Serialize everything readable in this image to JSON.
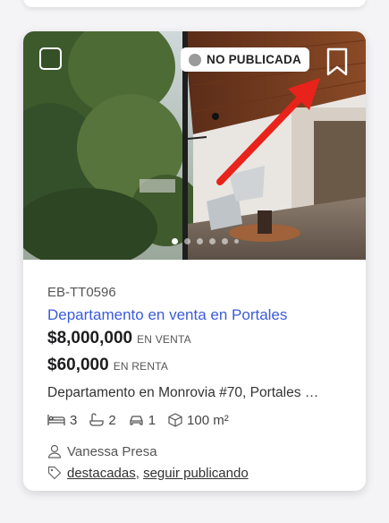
{
  "listing": {
    "status_badge": "NO PUBLICADA",
    "code": "EB-TT0596",
    "title": "Departamento en venta en Portales",
    "sale_price": "$8,000,000",
    "sale_label": "EN VENTA",
    "rent_price": "$60,000",
    "rent_label": "EN RENTA",
    "description": "Departamento en Monrovia #70, Portales …",
    "bedrooms": "3",
    "bathrooms": "2",
    "parking": "1",
    "area": "100 m²",
    "agent": "Vanessa Presa",
    "tags": [
      "destacadas",
      "seguir publicando"
    ],
    "tag_separator": ", "
  },
  "carousel": {
    "dot_count": 6,
    "active_index": 0
  },
  "colors": {
    "accent": "#3b5bdb",
    "badge_dot": "#9a9a9a",
    "arrow": "#e8231b"
  },
  "icons": [
    "checkbox-icon",
    "bookmark-icon",
    "bed-icon",
    "bath-icon",
    "car-icon",
    "area-cube-icon",
    "user-icon",
    "tag-icon"
  ]
}
